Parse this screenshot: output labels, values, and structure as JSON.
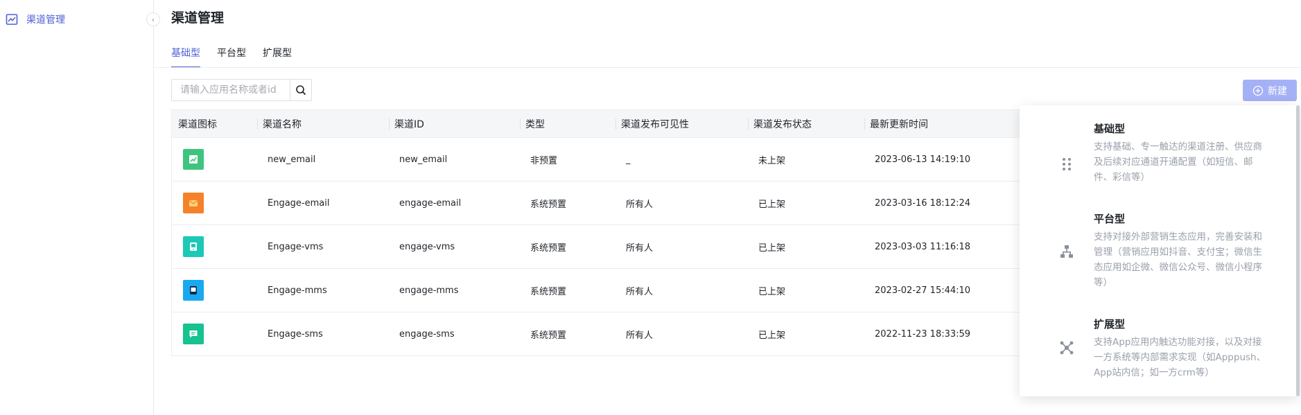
{
  "sidebar": {
    "item_label": "渠道管理"
  },
  "page": {
    "title": "渠道管理"
  },
  "tabs": [
    {
      "label": "基础型"
    },
    {
      "label": "平台型"
    },
    {
      "label": "扩展型"
    }
  ],
  "search": {
    "placeholder": "请输入应用名称或者id"
  },
  "new_button": {
    "label": "新建"
  },
  "table": {
    "columns": [
      "渠道图标",
      "渠道名称",
      "渠道ID",
      "类型",
      "渠道发布可见性",
      "渠道发布状态",
      "最新更新时间"
    ],
    "rows": [
      {
        "icon": "email-channel-icon",
        "icon_color": "#3dc47e",
        "name": "new_email",
        "id": "new_email",
        "type": "非预置",
        "visibility": "_",
        "status": "未上架",
        "updated": "2023-06-13 14:19:10"
      },
      {
        "icon": "engage-email-icon",
        "icon_color": "#f5812a",
        "name": "Engage-email",
        "id": "engage-email",
        "type": "系统预置",
        "visibility": "所有人",
        "status": "已上架",
        "updated": "2023-03-16 18:12:24"
      },
      {
        "icon": "engage-vms-icon",
        "icon_color": "#1bc9b6",
        "name": "Engage-vms",
        "id": "engage-vms",
        "type": "系统预置",
        "visibility": "所有人",
        "status": "已上架",
        "updated": "2023-03-03 11:16:18"
      },
      {
        "icon": "engage-mms-icon",
        "icon_color": "#18a9f0",
        "name": "Engage-mms",
        "id": "engage-mms",
        "type": "系统预置",
        "visibility": "所有人",
        "status": "已上架",
        "updated": "2023-02-27 15:44:10"
      },
      {
        "icon": "engage-sms-icon",
        "icon_color": "#16c28f",
        "name": "Engage-sms",
        "id": "engage-sms",
        "type": "系统预置",
        "visibility": "所有人",
        "status": "已上架",
        "updated": "2022-11-23 18:33:59"
      }
    ]
  },
  "dropdown": {
    "items": [
      {
        "title": "基础型",
        "description": "支持基础、专一触达的渠道注册、供应商及后续对应通道开通配置（如短信、邮件、彩信等）",
        "icon": "dots-grid-icon"
      },
      {
        "title": "平台型",
        "description": "支持对接外部营销生态应用，完善安装和管理（营销应用如抖音、支付宝；微信生态应用如企微、微信公众号、微信小程序等）",
        "icon": "hierarchy-icon"
      },
      {
        "title": "扩展型",
        "description": "支持App应用内触达功能对接，以及对接一方系统等内部需求实现（如Apppush、App站内信；如一方crm等）",
        "icon": "expand-nodes-icon"
      }
    ]
  },
  "colors": {
    "accent": "#4e5fd6",
    "new_button_bg": "#a5b1f6"
  }
}
